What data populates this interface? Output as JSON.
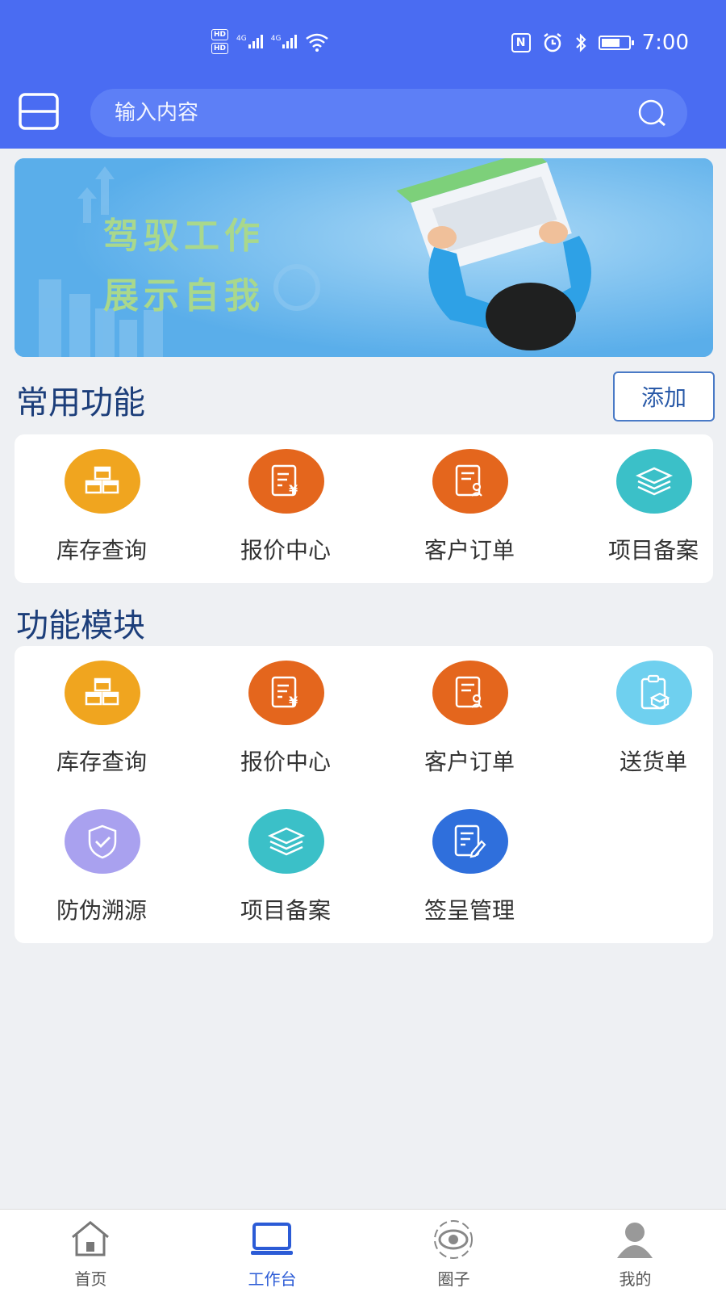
{
  "status_bar": {
    "hd1": "HD",
    "hd2": "HD",
    "net1": "4G",
    "net2": "4G",
    "nfc": "N",
    "time": "7:00"
  },
  "search": {
    "placeholder": "输入内容"
  },
  "banner": {
    "line1": "驾驭工作",
    "line2": "展示自我"
  },
  "common": {
    "title": "常用功能",
    "add_label": "添加",
    "items": [
      {
        "label": "库存查询",
        "icon": "boxes-icon",
        "color": "#f0a51f"
      },
      {
        "label": "报价中心",
        "icon": "quote-icon",
        "color": "#e4661d"
      },
      {
        "label": "客户订单",
        "icon": "order-icon",
        "color": "#e4661d"
      },
      {
        "label": "项目备案",
        "icon": "layers-icon",
        "color": "#3bc0c8"
      }
    ]
  },
  "modules": {
    "title": "功能模块",
    "items": [
      {
        "label": "库存查询",
        "icon": "boxes-icon",
        "color": "#f0a51f"
      },
      {
        "label": "报价中心",
        "icon": "quote-icon",
        "color": "#e4661d"
      },
      {
        "label": "客户订单",
        "icon": "order-icon",
        "color": "#e4661d"
      },
      {
        "label": "送货单",
        "icon": "delivery-icon",
        "color": "#6fd0ef"
      },
      {
        "label": "防伪溯源",
        "icon": "shield-icon",
        "color": "#a9a1ef"
      },
      {
        "label": "项目备案",
        "icon": "layers-icon",
        "color": "#3bc0c8"
      },
      {
        "label": "签呈管理",
        "icon": "sign-icon",
        "color": "#2f6fdc"
      }
    ]
  },
  "nav": {
    "items": [
      {
        "label": "首页",
        "icon": "home-icon"
      },
      {
        "label": "工作台",
        "icon": "laptop-icon",
        "active": true
      },
      {
        "label": "圈子",
        "icon": "circle-eye-icon"
      },
      {
        "label": "我的",
        "icon": "user-icon"
      }
    ],
    "accent": "#2b5bd6"
  }
}
